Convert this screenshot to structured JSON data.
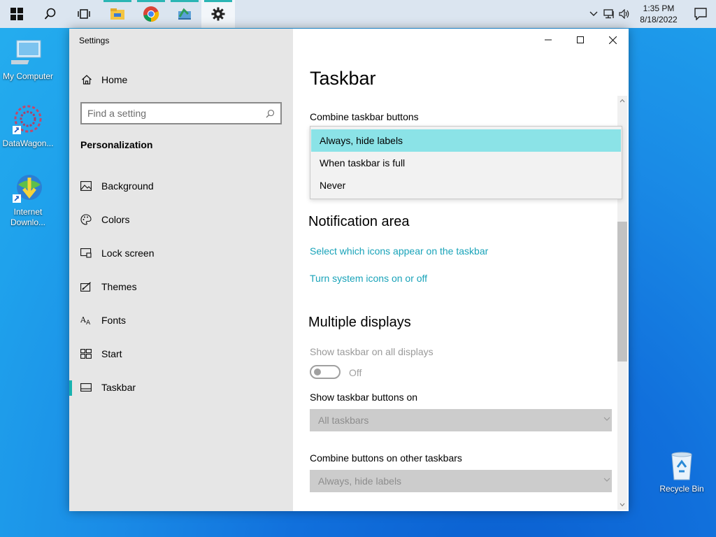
{
  "taskbar": {
    "clock_time": "1:35 PM",
    "clock_date": "8/18/2022",
    "buttons": [
      "start-icon",
      "search-icon",
      "task-view-icon",
      "file-explorer-icon",
      "chrome-icon",
      "app-icon",
      "settings-icon"
    ],
    "accent": "#2bb5b4"
  },
  "desktop": {
    "icons": [
      {
        "label": "My Computer"
      },
      {
        "label": "DataWagon..."
      },
      {
        "label_line1": "Internet",
        "label_line2": "Downlo..."
      },
      {
        "label": "Recycle Bin"
      }
    ]
  },
  "window": {
    "title": "Settings",
    "nav": {
      "home": "Home",
      "search_placeholder": "Find a setting",
      "section": "Personalization",
      "items": [
        {
          "label": "Background",
          "icon": "picture-icon"
        },
        {
          "label": "Colors",
          "icon": "palette-icon"
        },
        {
          "label": "Lock screen",
          "icon": "lock-screen-icon"
        },
        {
          "label": "Themes",
          "icon": "themes-icon"
        },
        {
          "label": "Fonts",
          "icon": "fonts-icon"
        },
        {
          "label": "Start",
          "icon": "start-icon"
        },
        {
          "label": "Taskbar",
          "icon": "taskbar-icon",
          "selected": true
        }
      ]
    },
    "content": {
      "title": "Taskbar",
      "combine_label": "Combine taskbar buttons",
      "combine_options": [
        "Always, hide labels",
        "When taskbar is full",
        "Never"
      ],
      "combine_selected": "Always, hide labels",
      "notification_heading": "Notification area",
      "link1": "Select which icons appear on the taskbar",
      "link2": "Turn system icons on or off",
      "multiple_heading": "Multiple displays",
      "show_all_label": "Show taskbar on all displays",
      "show_all_state": "Off",
      "buttons_on_label": "Show taskbar buttons on",
      "buttons_on_value": "All taskbars",
      "combine_other_label": "Combine buttons on other taskbars",
      "combine_other_value": "Always, hide labels"
    },
    "colors": {
      "accent": "#17b2b0",
      "link": "#19a3b9",
      "selection": "#8be3e7"
    }
  }
}
